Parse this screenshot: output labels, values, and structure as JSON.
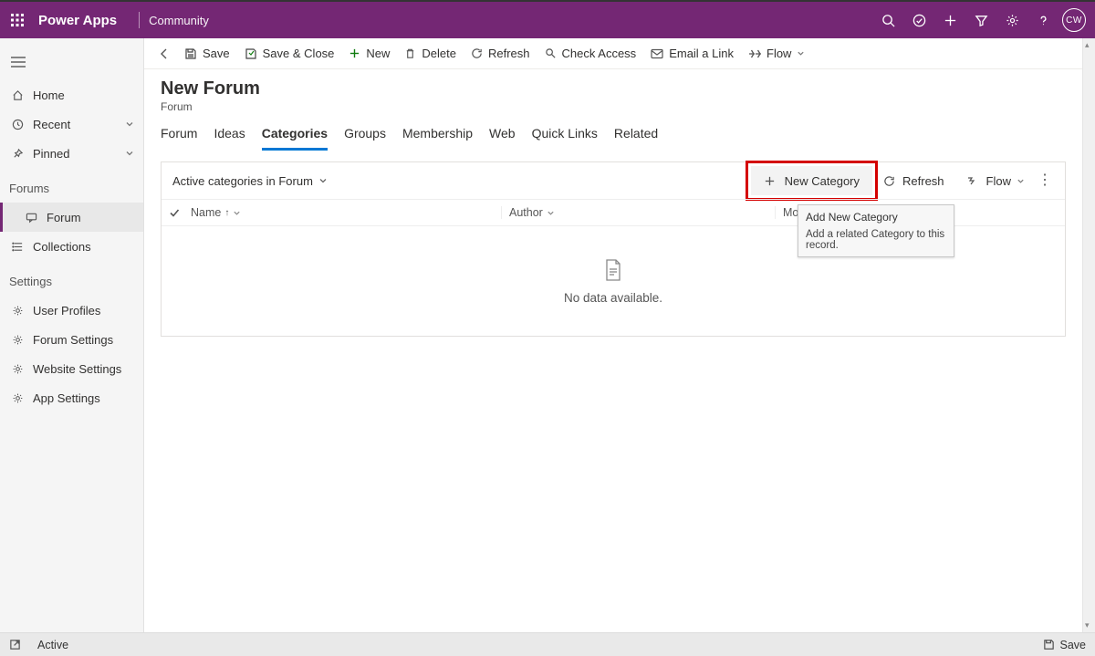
{
  "topbar": {
    "app_name": "Power Apps",
    "env_name": "Community",
    "avatar_initials": "CW"
  },
  "leftnav": {
    "home": "Home",
    "recent": "Recent",
    "pinned": "Pinned",
    "group_forums": "Forums",
    "forum": "Forum",
    "collections": "Collections",
    "group_settings": "Settings",
    "user_profiles": "User Profiles",
    "forum_settings": "Forum Settings",
    "website_settings": "Website Settings",
    "app_settings": "App Settings"
  },
  "cmdbar": {
    "save": "Save",
    "save_close": "Save & Close",
    "new": "New",
    "delete": "Delete",
    "refresh": "Refresh",
    "check_access": "Check Access",
    "email_link": "Email a Link",
    "flow": "Flow"
  },
  "header": {
    "title": "New Forum",
    "entity": "Forum"
  },
  "tabs": {
    "forum": "Forum",
    "ideas": "Ideas",
    "categories": "Categories",
    "groups": "Groups",
    "membership": "Membership",
    "web": "Web",
    "quick_links": "Quick Links",
    "related": "Related"
  },
  "subgrid": {
    "view_name": "Active categories in Forum",
    "new_category": "New Category",
    "refresh": "Refresh",
    "flow": "Flow",
    "tooltip_title": "Add New Category",
    "tooltip_body": "Add a related Category to this record.",
    "col_name": "Name",
    "col_author": "Author",
    "col_modified": "Modified On",
    "empty_text": "No data available."
  },
  "footer": {
    "status": "Active",
    "save": "Save"
  }
}
